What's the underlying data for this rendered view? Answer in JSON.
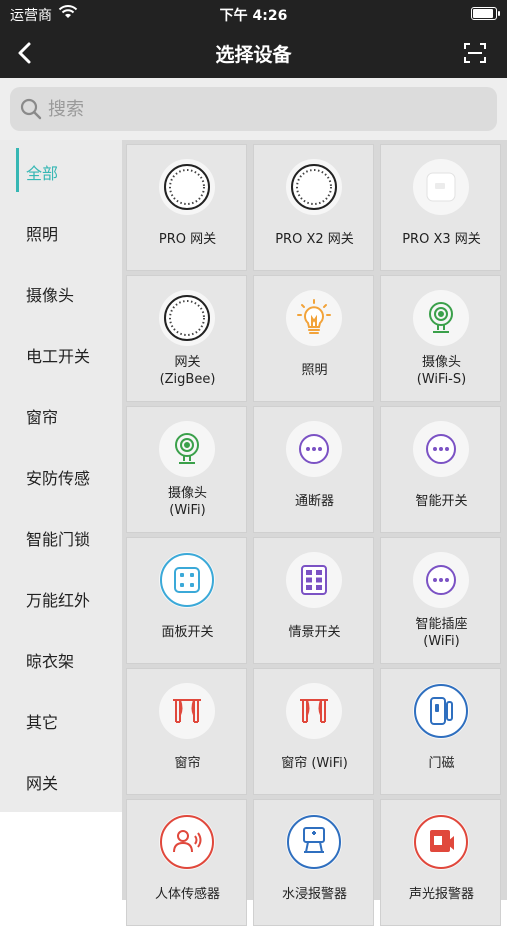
{
  "status_bar": {
    "carrier": "运营商",
    "time": "下午 4:26"
  },
  "nav": {
    "title": "选择设备"
  },
  "search": {
    "placeholder": "搜索"
  },
  "sidebar": {
    "items": [
      {
        "label": "全部",
        "active": true
      },
      {
        "label": "照明"
      },
      {
        "label": "摄像头"
      },
      {
        "label": "电工开关"
      },
      {
        "label": "窗帘"
      },
      {
        "label": "安防传感"
      },
      {
        "label": "智能门锁"
      },
      {
        "label": "万能红外"
      },
      {
        "label": "晾衣架"
      },
      {
        "label": "其它"
      },
      {
        "label": "网关"
      }
    ]
  },
  "devices": [
    {
      "label": "PRO 网关",
      "icon": "gateway-ring-icon"
    },
    {
      "label": "PRO X2 网关",
      "icon": "gateway-ring-icon"
    },
    {
      "label": "PRO X3 网关",
      "icon": "gateway-box-icon"
    },
    {
      "label": "网关\n(ZigBee)",
      "icon": "gateway-ring-icon"
    },
    {
      "label": "照明",
      "icon": "bulb-icon"
    },
    {
      "label": "摄像头\n(WiFi-S)",
      "icon": "camera-icon"
    },
    {
      "label": "摄像头\n(WiFi)",
      "icon": "camera-icon"
    },
    {
      "label": "通断器",
      "icon": "more-dots-icon"
    },
    {
      "label": "智能开关",
      "icon": "more-dots-icon"
    },
    {
      "label": "面板开关",
      "icon": "panel-switch-icon"
    },
    {
      "label": "情景开关",
      "icon": "scene-switch-icon"
    },
    {
      "label": "智能插座\n(WiFi)",
      "icon": "more-dots-icon"
    },
    {
      "label": "窗帘",
      "icon": "curtain-icon"
    },
    {
      "label": "窗帘 (WiFi)",
      "icon": "curtain-icon"
    },
    {
      "label": "门磁",
      "icon": "door-sensor-icon"
    },
    {
      "label": "人体传感器",
      "icon": "motion-sensor-icon"
    },
    {
      "label": "水浸报警器",
      "icon": "water-alarm-icon"
    },
    {
      "label": "声光报警器",
      "icon": "siren-icon"
    }
  ],
  "colors": {
    "accent": "#36b7b4",
    "header_bg": "#222222",
    "purple": "#7b52c4",
    "red": "#e0483c",
    "blue": "#2f6fbf",
    "green": "#3aa04a",
    "orange": "#f2a33a",
    "cyan": "#3ba9d8"
  }
}
